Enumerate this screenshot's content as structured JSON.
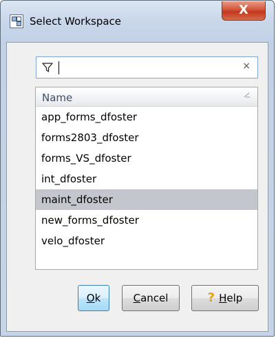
{
  "window": {
    "title": "Select Workspace"
  },
  "titlebar": {
    "close_glyph": "X"
  },
  "search": {
    "value": "",
    "placeholder": "",
    "clear_glyph": "×"
  },
  "list": {
    "header": "Name",
    "items": [
      "app_forms_dfoster",
      "forms2803_dfoster",
      "forms_VS_dfoster",
      "int_dfoster",
      "maint_dfoster",
      "new_forms_dfoster",
      "velo_dfoster"
    ],
    "selected_index": 4
  },
  "buttons": {
    "ok": {
      "mnemonic": "O",
      "rest": "k"
    },
    "cancel": {
      "mnemonic": "C",
      "rest": "ancel"
    },
    "help": {
      "mnemonic": "H",
      "rest": "elp",
      "icon": "help-icon"
    }
  },
  "colors": {
    "selection": "#c3c6cd",
    "close_button": "#c2371f",
    "default_button_border": "#3c7fb1"
  }
}
